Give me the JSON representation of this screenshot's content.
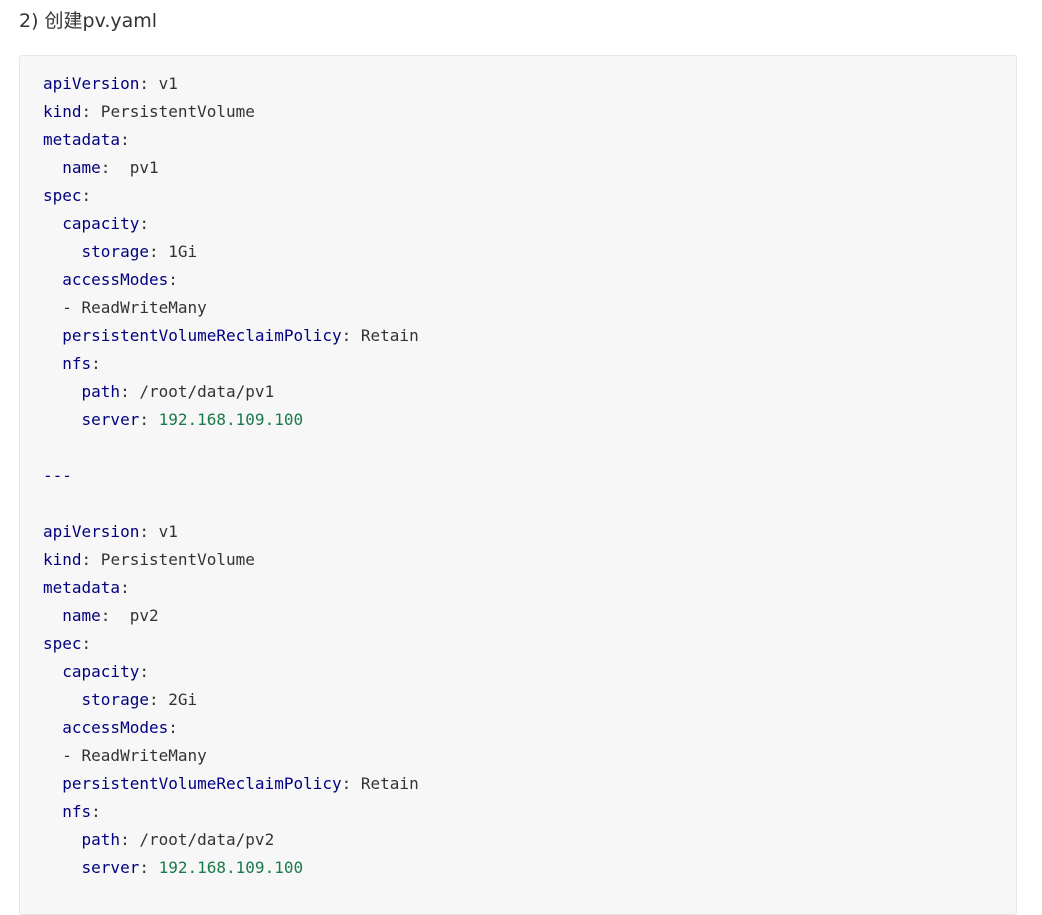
{
  "heading": "2) 创建pv.yaml",
  "code_lines": [
    {
      "indent": "",
      "key": "apiVersion",
      "colon": ":",
      "value": " v1",
      "value_type": "plain"
    },
    {
      "indent": "",
      "key": "kind",
      "colon": ":",
      "value": " PersistentVolume",
      "value_type": "plain"
    },
    {
      "indent": "",
      "key": "metadata",
      "colon": ":",
      "value": "",
      "value_type": "plain"
    },
    {
      "indent": "  ",
      "key": "name",
      "colon": ":",
      "value": "  pv1",
      "value_type": "plain"
    },
    {
      "indent": "",
      "key": "spec",
      "colon": ":",
      "value": "",
      "value_type": "plain"
    },
    {
      "indent": "  ",
      "key": "capacity",
      "colon": ":",
      "value": "",
      "value_type": "plain"
    },
    {
      "indent": "    ",
      "key": "storage",
      "colon": ":",
      "value": " 1Gi",
      "value_type": "plain"
    },
    {
      "indent": "  ",
      "key": "accessModes",
      "colon": ":",
      "value": "",
      "value_type": "plain"
    },
    {
      "indent": "  ",
      "key": "",
      "colon": "",
      "value": "- ReadWriteMany",
      "value_type": "plain"
    },
    {
      "indent": "  ",
      "key": "persistentVolumeReclaimPolicy",
      "colon": ":",
      "value": " Retain",
      "value_type": "plain"
    },
    {
      "indent": "  ",
      "key": "nfs",
      "colon": ":",
      "value": "",
      "value_type": "plain"
    },
    {
      "indent": "    ",
      "key": "path",
      "colon": ":",
      "value": " /root/data/pv1",
      "value_type": "plain"
    },
    {
      "indent": "    ",
      "key": "server",
      "colon": ":",
      "value": " 192.168.109.100",
      "value_type": "number"
    },
    {
      "indent": "",
      "key": "",
      "colon": "",
      "value": "",
      "value_type": "plain"
    },
    {
      "indent": "",
      "key": "",
      "colon": "",
      "value": "---",
      "value_type": "separator"
    },
    {
      "indent": "",
      "key": "",
      "colon": "",
      "value": "",
      "value_type": "plain"
    },
    {
      "indent": "",
      "key": "apiVersion",
      "colon": ":",
      "value": " v1",
      "value_type": "plain"
    },
    {
      "indent": "",
      "key": "kind",
      "colon": ":",
      "value": " PersistentVolume",
      "value_type": "plain"
    },
    {
      "indent": "",
      "key": "metadata",
      "colon": ":",
      "value": "",
      "value_type": "plain"
    },
    {
      "indent": "  ",
      "key": "name",
      "colon": ":",
      "value": "  pv2",
      "value_type": "plain"
    },
    {
      "indent": "",
      "key": "spec",
      "colon": ":",
      "value": "",
      "value_type": "plain"
    },
    {
      "indent": "  ",
      "key": "capacity",
      "colon": ":",
      "value": "",
      "value_type": "plain"
    },
    {
      "indent": "    ",
      "key": "storage",
      "colon": ":",
      "value": " 2Gi",
      "value_type": "plain"
    },
    {
      "indent": "  ",
      "key": "accessModes",
      "colon": ":",
      "value": "",
      "value_type": "plain"
    },
    {
      "indent": "  ",
      "key": "",
      "colon": "",
      "value": "- ReadWriteMany",
      "value_type": "plain"
    },
    {
      "indent": "  ",
      "key": "persistentVolumeReclaimPolicy",
      "colon": ":",
      "value": " Retain",
      "value_type": "plain"
    },
    {
      "indent": "  ",
      "key": "nfs",
      "colon": ":",
      "value": "",
      "value_type": "plain"
    },
    {
      "indent": "    ",
      "key": "path",
      "colon": ":",
      "value": " /root/data/pv2",
      "value_type": "plain"
    },
    {
      "indent": "    ",
      "key": "server",
      "colon": ":",
      "value": " 192.168.109.100",
      "value_type": "number"
    }
  ],
  "colors": {
    "key": "#000080",
    "number": "#1a7a4c",
    "text": "#333333",
    "code_background": "#f7f7f7"
  }
}
